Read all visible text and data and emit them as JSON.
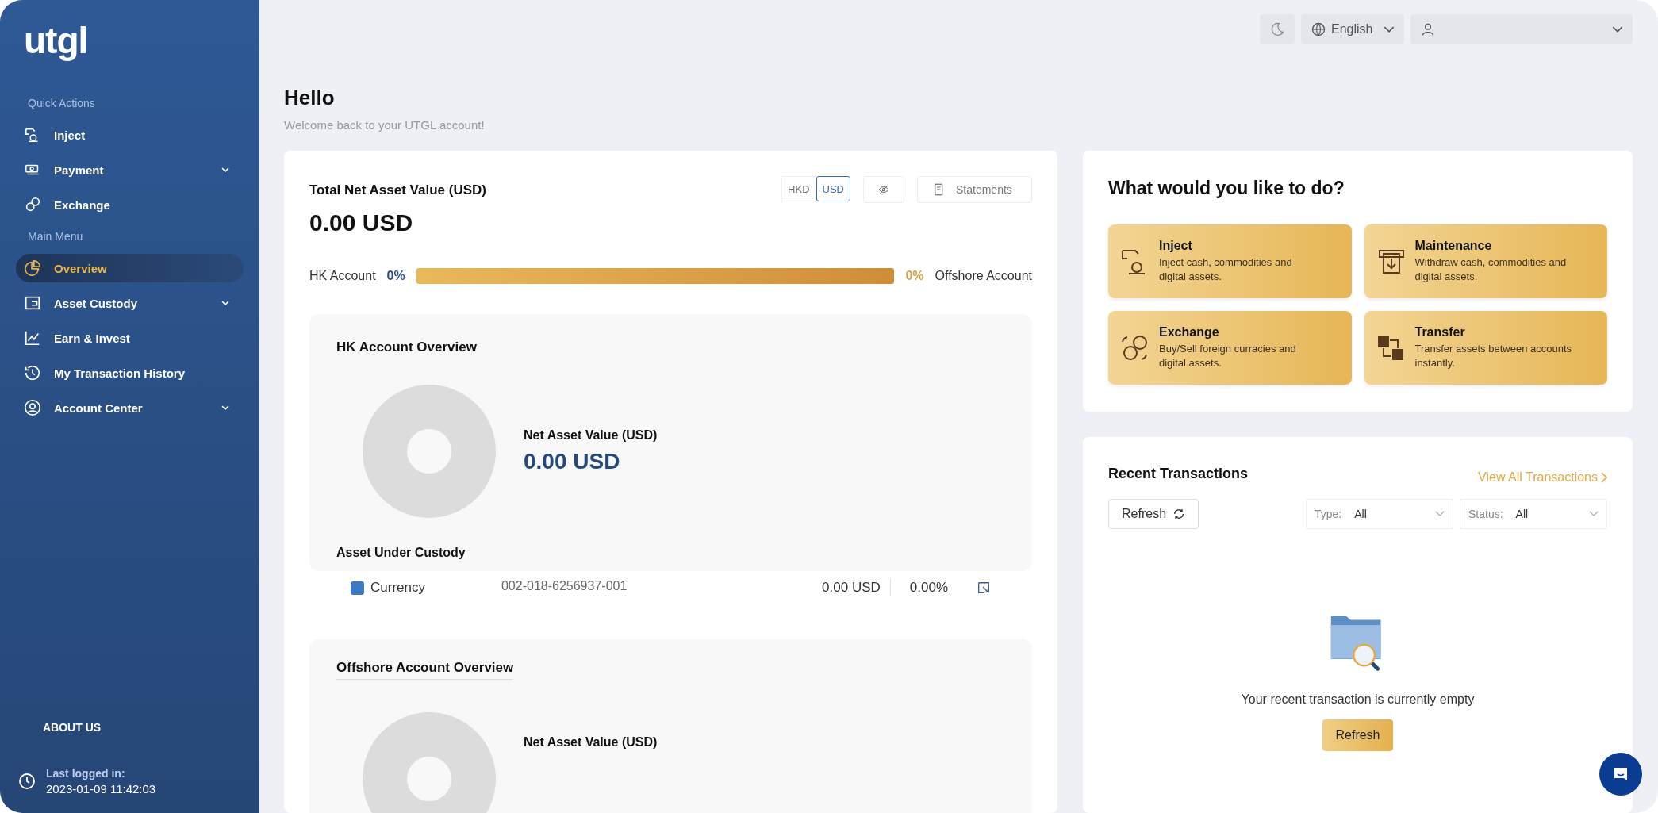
{
  "sidebar": {
    "logo": "utgl",
    "sections": [
      {
        "label": "Quick Actions",
        "items": [
          {
            "label": "Inject",
            "selected": false,
            "expandable": false
          },
          {
            "label": "Payment",
            "selected": false,
            "expandable": true
          },
          {
            "label": "Exchange",
            "selected": false,
            "expandable": false
          }
        ]
      },
      {
        "label": "Main Menu",
        "items": [
          {
            "label": "Overview",
            "selected": true,
            "expandable": false
          },
          {
            "label": "Asset Custody",
            "selected": false,
            "expandable": true
          },
          {
            "label": "Earn & Invest",
            "selected": false,
            "expandable": false
          },
          {
            "label": "My Transaction History",
            "selected": false,
            "expandable": false
          },
          {
            "label": "Account Center",
            "selected": false,
            "expandable": true
          }
        ]
      }
    ],
    "about": "ABOUT US",
    "last_login_label": "Last logged in:",
    "last_login": "2023-01-09 11:42:03"
  },
  "topbar": {
    "language": "English"
  },
  "greeting": {
    "title": "Hello",
    "subtitle": "Welcome back to your UTGL account!"
  },
  "net_asset": {
    "title": "Total Net Asset Value (USD)",
    "value": "0.00 USD",
    "currencies": [
      {
        "label": "HKD",
        "selected": false
      },
      {
        "label": "USD",
        "selected": true
      }
    ],
    "statements": "Statements",
    "split": {
      "left_label": "HK Account",
      "left_pct": "0%",
      "right_pct": "0%",
      "right_label": "Offshore Account"
    }
  },
  "hk_overview": {
    "title": "HK Account Overview",
    "nav_label": "Net Asset Value (USD)",
    "nav_value": "0.00 USD",
    "custody_title": "Asset Under Custody",
    "rows": [
      {
        "name": "Currency",
        "color": "#3b7ac4",
        "account": "002-018-6256937-001",
        "amount": "0.00 USD",
        "share": "0.00%"
      }
    ]
  },
  "offshore_overview": {
    "title": "Offshore Account Overview",
    "nav_label": "Net Asset Value (USD)"
  },
  "actions": {
    "title": "What would you like to do?",
    "items": [
      {
        "title": "Inject",
        "text": "Inject cash, commodities and digital assets."
      },
      {
        "title": "Maintenance",
        "text": "Withdraw cash, commodities and digital assets."
      },
      {
        "title": "Exchange",
        "text": "Buy/Sell foreign curracies and digital assets."
      },
      {
        "title": "Transfer",
        "text": "Transfer assets between accounts instantly."
      }
    ]
  },
  "recent": {
    "title": "Recent Transactions",
    "view_all": "View All Transactions",
    "refresh": "Refresh",
    "filters": [
      {
        "label": "Type:",
        "value": "All"
      },
      {
        "label": "Status:",
        "value": "All"
      }
    ],
    "empty": "Your recent transaction is currently empty",
    "empty_button": "Refresh"
  }
}
